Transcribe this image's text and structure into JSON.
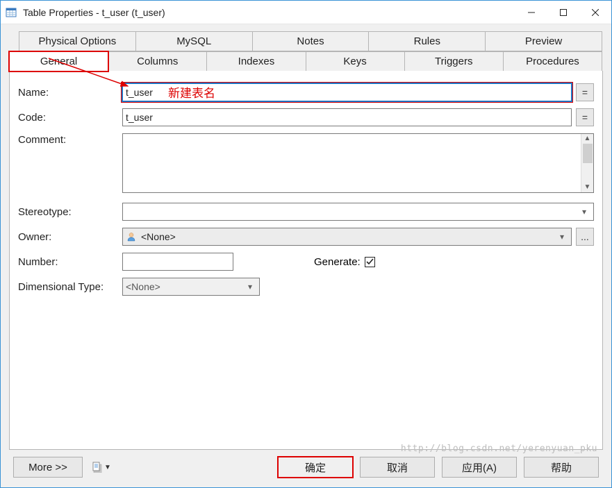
{
  "window": {
    "title": "Table Properties - t_user (t_user)"
  },
  "tabs": {
    "upper": [
      {
        "label": "Physical Options"
      },
      {
        "label": "MySQL"
      },
      {
        "label": "Notes"
      },
      {
        "label": "Rules"
      },
      {
        "label": "Preview"
      }
    ],
    "lower": [
      {
        "label": "General"
      },
      {
        "label": "Columns"
      },
      {
        "label": "Indexes"
      },
      {
        "label": "Keys"
      },
      {
        "label": "Triggers"
      },
      {
        "label": "Procedures"
      }
    ]
  },
  "form": {
    "name_label": "Name:",
    "name_value": "t_user",
    "code_label": "Code:",
    "code_value": "t_user",
    "comment_label": "Comment:",
    "stereotype_label": "Stereotype:",
    "stereotype_value": "",
    "owner_label": "Owner:",
    "owner_value": "<None>",
    "number_label": "Number:",
    "number_value": "",
    "generate_label": "Generate:",
    "generate_checked": true,
    "dimtype_label": "Dimensional Type:",
    "dimtype_value": "<None>",
    "equals_btn": "="
  },
  "annotation": {
    "text": "新建表名"
  },
  "buttons": {
    "more": "More >>",
    "ok": "确定",
    "cancel": "取消",
    "apply": "应用(A)",
    "help": "帮助"
  },
  "watermark": "http://blog.csdn.net/yerenyuan_pku"
}
